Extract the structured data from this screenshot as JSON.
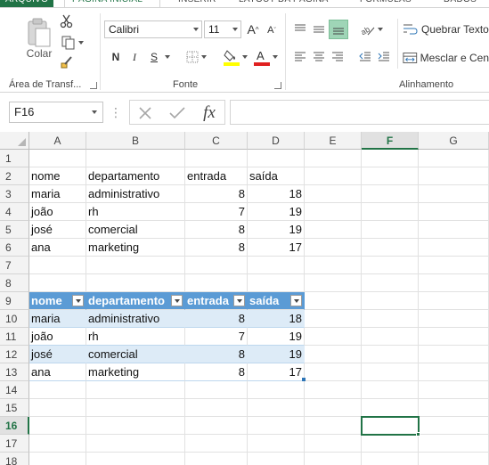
{
  "tabs": {
    "file": "ARQUIVO",
    "home": "PÁGINA INICIAL",
    "insert": "INSERIR",
    "layout": "LAYOUT DA PÁGINA",
    "formulas": "FÓRMULAS",
    "data": "DADOS"
  },
  "ribbon": {
    "clipboard": {
      "paste_label": "Colar",
      "group_label": "Área de Transf..."
    },
    "font": {
      "font_name": "Calibri",
      "font_size": "11",
      "bold": "N",
      "italic": "I",
      "underline": "S",
      "increase": "A",
      "decrease": "A",
      "group_label": "Fonte"
    },
    "alignment": {
      "wrap_text": "Quebrar Texto",
      "merge": "Mesclar e Cen",
      "group_label": "Alinhamento"
    }
  },
  "formula_bar": {
    "name_box": "F16",
    "fx": "fx",
    "formula": ""
  },
  "columns": [
    "A",
    "B",
    "C",
    "D",
    "E",
    "F",
    "G"
  ],
  "selected_column": "F",
  "rows": [
    "1",
    "2",
    "3",
    "4",
    "5",
    "6",
    "7",
    "8",
    "9",
    "10",
    "11",
    "12",
    "13",
    "14",
    "15",
    "16",
    "17",
    "18"
  ],
  "selected_row": "16",
  "active_cell": "F16",
  "range1": {
    "headers": [
      "nome",
      "departamento",
      "entrada",
      "saída"
    ],
    "data": [
      [
        "maria",
        "administrativo",
        "8",
        "18"
      ],
      [
        "joão",
        "rh",
        "7",
        "19"
      ],
      [
        "josé",
        "comercial",
        "8",
        "19"
      ],
      [
        "ana",
        "marketing",
        "8",
        "17"
      ]
    ]
  },
  "table1": {
    "headers": [
      "nome",
      "departamento",
      "entrada",
      "saída"
    ],
    "data": [
      [
        "maria",
        "administrativo",
        "8",
        "18"
      ],
      [
        "joão",
        "rh",
        "7",
        "19"
      ],
      [
        "josé",
        "comercial",
        "8",
        "19"
      ],
      [
        "ana",
        "marketing",
        "8",
        "17"
      ]
    ],
    "header_color": "#5b9bd5",
    "band_color": "#ddebf7"
  },
  "accent_color": "#217346"
}
